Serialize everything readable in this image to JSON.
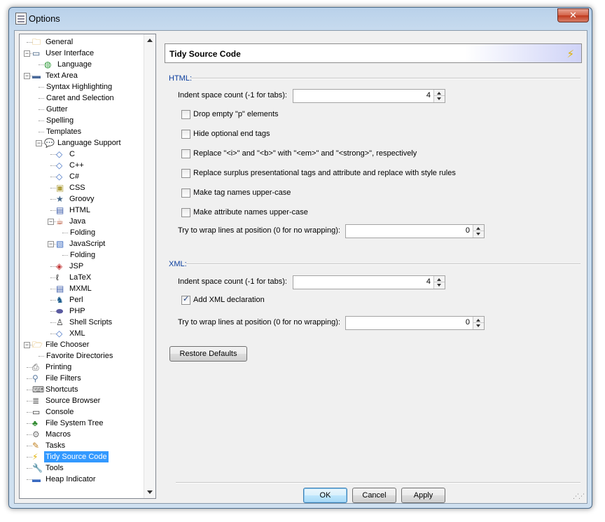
{
  "window": {
    "title": "Options"
  },
  "header": {
    "title": "Tidy Source Code"
  },
  "tree": {
    "items": [
      {
        "label": "General",
        "depth": 0,
        "exp": "",
        "icon": "folder-icon",
        "glyph": "🗀",
        "color": "#d9a53a"
      },
      {
        "label": "User Interface",
        "depth": 0,
        "exp": "−",
        "icon": "window-icon",
        "glyph": "▭",
        "color": "#33557a"
      },
      {
        "label": "Language",
        "depth": 1,
        "exp": "",
        "icon": "globe-icon",
        "glyph": "◍",
        "color": "#2f9a3a"
      },
      {
        "label": "Text Area",
        "depth": 0,
        "exp": "−",
        "icon": "text-area-icon",
        "glyph": "▬",
        "color": "#4a6a9a"
      },
      {
        "label": "Syntax Highlighting",
        "depth": 1,
        "exp": "",
        "icon": "",
        "glyph": "",
        "color": ""
      },
      {
        "label": "Caret and Selection",
        "depth": 1,
        "exp": "",
        "icon": "",
        "glyph": "",
        "color": ""
      },
      {
        "label": "Gutter",
        "depth": 1,
        "exp": "",
        "icon": "",
        "glyph": "",
        "color": ""
      },
      {
        "label": "Spelling",
        "depth": 1,
        "exp": "",
        "icon": "",
        "glyph": "",
        "color": ""
      },
      {
        "label": "Templates",
        "depth": 1,
        "exp": "",
        "icon": "",
        "glyph": "",
        "color": ""
      },
      {
        "label": "Language Support",
        "depth": 1,
        "exp": "−",
        "icon": "speech-bubble-icon",
        "glyph": "💬",
        "color": "#5a8ac0"
      },
      {
        "label": "C",
        "depth": 2,
        "exp": "",
        "icon": "c-file-icon",
        "glyph": "◇",
        "color": "#3a6ac0"
      },
      {
        "label": "C++",
        "depth": 2,
        "exp": "",
        "icon": "cpp-file-icon",
        "glyph": "◇",
        "color": "#3a6ac0"
      },
      {
        "label": "C#",
        "depth": 2,
        "exp": "",
        "icon": "csharp-file-icon",
        "glyph": "◇",
        "color": "#3a6ac0"
      },
      {
        "label": "CSS",
        "depth": 2,
        "exp": "",
        "icon": "css-file-icon",
        "glyph": "▣",
        "color": "#b0a040"
      },
      {
        "label": "Groovy",
        "depth": 2,
        "exp": "",
        "icon": "groovy-icon",
        "glyph": "★",
        "color": "#446688"
      },
      {
        "label": "HTML",
        "depth": 2,
        "exp": "",
        "icon": "html-file-icon",
        "glyph": "▤",
        "color": "#3a5aa8"
      },
      {
        "label": "Java",
        "depth": 2,
        "exp": "−",
        "icon": "java-cup-icon",
        "glyph": "☕",
        "color": "#b04020"
      },
      {
        "label": "Folding",
        "depth": 3,
        "exp": "",
        "icon": "",
        "glyph": "",
        "color": ""
      },
      {
        "label": "JavaScript",
        "depth": 2,
        "exp": "−",
        "icon": "javascript-file-icon",
        "glyph": "▧",
        "color": "#3a6ac0"
      },
      {
        "label": "Folding",
        "depth": 3,
        "exp": "",
        "icon": "",
        "glyph": "",
        "color": ""
      },
      {
        "label": "JSP",
        "depth": 2,
        "exp": "",
        "icon": "jsp-file-icon",
        "glyph": "◈",
        "color": "#c03030"
      },
      {
        "label": "LaTeX",
        "depth": 2,
        "exp": "",
        "icon": "latex-icon",
        "glyph": "ℓ",
        "color": "#222222"
      },
      {
        "label": "MXML",
        "depth": 2,
        "exp": "",
        "icon": "mxml-file-icon",
        "glyph": "▤",
        "color": "#3a5aa8"
      },
      {
        "label": "Perl",
        "depth": 2,
        "exp": "",
        "icon": "camel-icon",
        "glyph": "♞",
        "color": "#1a5a8a"
      },
      {
        "label": "PHP",
        "depth": 2,
        "exp": "",
        "icon": "php-icon",
        "glyph": "⬬",
        "color": "#5a5aa0"
      },
      {
        "label": "Shell Scripts",
        "depth": 2,
        "exp": "",
        "icon": "penguin-icon",
        "glyph": "♙",
        "color": "#222222"
      },
      {
        "label": "XML",
        "depth": 2,
        "exp": "",
        "icon": "xml-file-icon",
        "glyph": "◇",
        "color": "#3a6ac0"
      },
      {
        "label": "File Chooser",
        "depth": 0,
        "exp": "−",
        "icon": "open-folder-icon",
        "glyph": "🗁",
        "color": "#d9a53a"
      },
      {
        "label": "Favorite Directories",
        "depth": 1,
        "exp": "",
        "icon": "",
        "glyph": "",
        "color": ""
      },
      {
        "label": "Printing",
        "depth": 0,
        "exp": "",
        "icon": "printer-icon",
        "glyph": "⎙",
        "color": "#555555"
      },
      {
        "label": "File Filters",
        "depth": 0,
        "exp": "",
        "icon": "filter-icon",
        "glyph": "⚲",
        "color": "#5a7aa0"
      },
      {
        "label": "Shortcuts",
        "depth": 0,
        "exp": "",
        "icon": "keyboard-icon",
        "glyph": "⌨",
        "color": "#555555"
      },
      {
        "label": "Source Browser",
        "depth": 0,
        "exp": "",
        "icon": "source-browser-icon",
        "glyph": "≣",
        "color": "#555555"
      },
      {
        "label": "Console",
        "depth": 0,
        "exp": "",
        "icon": "monitor-icon",
        "glyph": "▭",
        "color": "#333333"
      },
      {
        "label": "File System Tree",
        "depth": 0,
        "exp": "",
        "icon": "tree-icon",
        "glyph": "♣",
        "color": "#2f8a2f"
      },
      {
        "label": "Macros",
        "depth": 0,
        "exp": "",
        "icon": "macro-gear-icon",
        "glyph": "⚙",
        "color": "#777777"
      },
      {
        "label": "Tasks",
        "depth": 0,
        "exp": "",
        "icon": "pencil-icon",
        "glyph": "✎",
        "color": "#c08020"
      },
      {
        "label": "Tidy Source Code",
        "depth": 0,
        "exp": "",
        "icon": "lightning-icon",
        "glyph": "⚡",
        "color": "#e0b000",
        "selected": true
      },
      {
        "label": "Tools",
        "depth": 0,
        "exp": "",
        "icon": "wrench-icon",
        "glyph": "🔧",
        "color": "#777777"
      },
      {
        "label": "Heap Indicator",
        "depth": 0,
        "exp": "",
        "icon": "heap-bar-icon",
        "glyph": "▬",
        "color": "#3a6ac0"
      }
    ]
  },
  "html_section": {
    "title": "HTML:",
    "indent_label": "Indent space count (-1 for tabs):",
    "indent_value": "4",
    "checkboxes": [
      {
        "label": "Drop empty \"p\" elements",
        "checked": false
      },
      {
        "label": "Hide optional end tags",
        "checked": false
      },
      {
        "label": "Replace \"<i>\" and \"<b>\" with \"<em>\" and \"<strong>\", respectively",
        "checked": false
      },
      {
        "label": "Replace surplus presentational tags and attribute and replace with style rules",
        "checked": false
      },
      {
        "label": "Make tag names upper-case",
        "checked": false
      },
      {
        "label": "Make attribute names upper-case",
        "checked": false
      }
    ],
    "wrap_label": "Try to wrap lines at position (0 for no wrapping):",
    "wrap_value": "0"
  },
  "xml_section": {
    "title": "XML:",
    "indent_label": "Indent space count (-1 for tabs):",
    "indent_value": "4",
    "add_decl_label": "Add XML declaration",
    "add_decl_checked": true,
    "wrap_label": "Try to wrap lines at position (0 for no wrapping):",
    "wrap_value": "0"
  },
  "buttons": {
    "restore": "Restore Defaults",
    "ok": "OK",
    "cancel": "Cancel",
    "apply": "Apply"
  }
}
